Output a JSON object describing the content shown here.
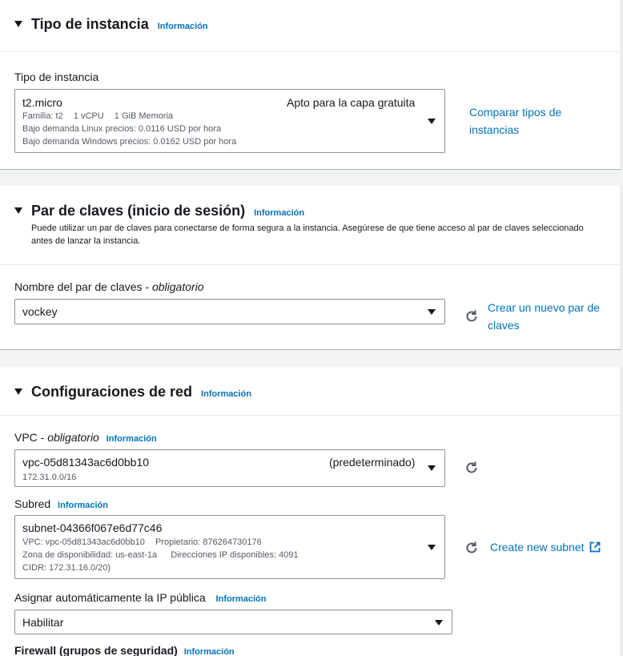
{
  "instance_type": {
    "title": "Tipo de instancia",
    "info": "Información",
    "field_label": "Tipo de instancia",
    "selected": "t2.micro",
    "badge": "Apto para la capa gratuita",
    "family": "Familia: t2",
    "vcpu": "1 vCPU",
    "memory": "1 GiB Memoria",
    "linux_price": "Bajo demanda Linux precios: 0.0116 USD por hora",
    "windows_price": "Bajo demanda Windows precios: 0.0162 USD por hora",
    "compare_link": "Comparar tipos de instancias"
  },
  "key_pair": {
    "title": "Par de claves (inicio de sesión)",
    "info": "Información",
    "description": "Puede utilizar un par de claves para conectarse de forma segura a la instancia. Asegúrese de que tiene acceso al par de claves seleccionado antes de lanzar la instancia.",
    "field_label": "Nombre del par de claves - ",
    "field_label_required": "obligatorio",
    "selected": "vockey",
    "create_link": "Crear un nuevo par de claves"
  },
  "network": {
    "title": "Configuraciones de red",
    "info": "Información",
    "vpc_label": "VPC - ",
    "vpc_required": "obligatorio",
    "vpc_info": "Información",
    "vpc_value": "vpc-05d81343ac6d0bb10",
    "vpc_default": "(predeterminado)",
    "vpc_cidr": "172.31.0.0/16",
    "subnet_label": "Subred",
    "subnet_info": "Información",
    "subnet_value": "subnet-04366f067e6d77c46",
    "subnet_vpc": "VPC: vpc-05d81343ac6d0bb10",
    "subnet_owner": "Propietario: 876264730176",
    "subnet_zone": "Zona de disponibilidad: us-east-1a",
    "subnet_ips": "Direcciones IP disponibles: 4091",
    "subnet_cidr": "CIDR: 172.31.16.0/20)",
    "create_subnet": "Create new subnet",
    "public_ip_label": "Asignar automáticamente la IP pública",
    "public_ip_info": "Información",
    "public_ip_value": "Habilitar",
    "firewall_label": "Firewall (grupos de seguridad)",
    "firewall_info": "Información"
  },
  "colors": {
    "link": "#0073bb",
    "border": "#879596",
    "text": "#16191f"
  }
}
